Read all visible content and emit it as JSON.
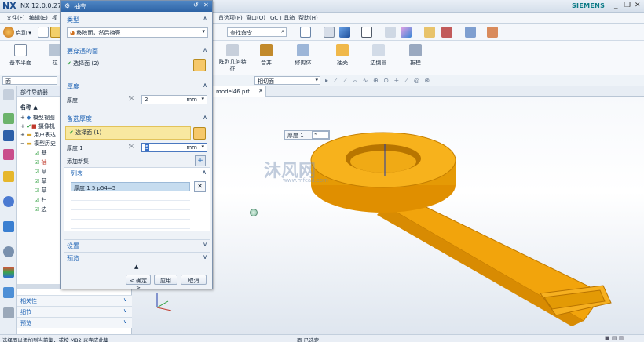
{
  "window": {
    "logo": "NX",
    "title": "NX 12.0.0.27",
    "brand": "SIEMENS"
  },
  "menubar": {
    "left": [
      "文件(F)",
      "编辑(E)",
      "视"
    ],
    "right": [
      "首选项(P)",
      "窗口(O)",
      "GC工具箱",
      "帮助(H)"
    ]
  },
  "toolbar": {
    "start_label": "启动 ▾",
    "search_placeholder": "查找命令",
    "big_buttons": [
      "基本平面",
      "拉",
      "阵列几何特\n征",
      "合并",
      "修剪体",
      "抽壳",
      "边倒圆",
      "拔模"
    ]
  },
  "selection_bar": {
    "filter": "面",
    "scope": "相切面"
  },
  "tab": {
    "name": "model46.prt"
  },
  "navigator": {
    "title": "部件导航器",
    "column": "名称 ▲",
    "items": [
      "模型视图",
      "摄像机",
      "用户表达",
      "模型历史",
      "基",
      "抽",
      "草",
      "草",
      "草",
      "扫",
      "边"
    ]
  },
  "left_panels": [
    "相关性",
    "细节",
    "预览"
  ],
  "dialog": {
    "title": "抽壳",
    "type_header": "类型",
    "type_value": "移除面，然后抽壳",
    "faces_header": "要穿透的面",
    "faces_select": "选择面 (2)",
    "thickness_header": "厚度",
    "thickness_label": "厚度",
    "thickness_value": "2",
    "thickness_unit": "mm",
    "alt_header": "备选厚度",
    "alt_select": "选择面 (1)",
    "alt_label": "厚度 1",
    "alt_value": "5",
    "alt_unit": "mm",
    "add_new": "添加新集",
    "list_header": "列表",
    "list_row": "厚度 1   5   p54=5",
    "settings": "设置",
    "preview": "预览",
    "ok": "< 确定 >",
    "apply": "应用",
    "cancel": "取消"
  },
  "viewport": {
    "callout_label": "厚度 1",
    "callout_value": "5",
    "watermark": "沐风网",
    "watermark_url": "www.mfcad.com",
    "part_color": "#f5a60c"
  },
  "status": {
    "left": "选择面以添加到当前集，或按 MB2 以完成此集",
    "mid": "面 已选定"
  }
}
